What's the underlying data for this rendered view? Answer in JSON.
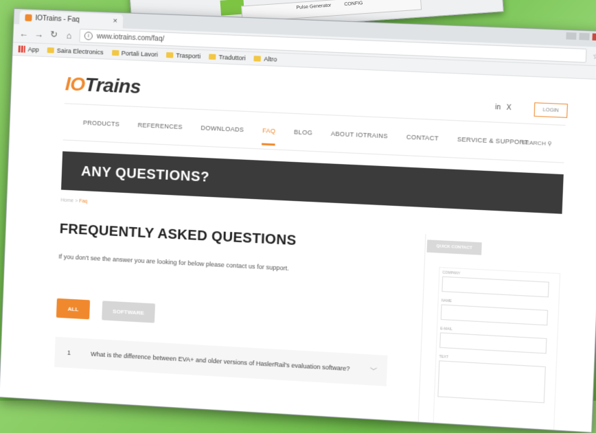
{
  "browser": {
    "tab_title": "IOTrains - Faq",
    "tab_close": "×",
    "url": "www.iotrains.com/faq/",
    "info_glyph": "i",
    "bookmarks": [
      "App",
      "Saira Electronics",
      "Portali Lavori",
      "Trasporti",
      "Traduttori",
      "Altro"
    ]
  },
  "site": {
    "logo_io": "IO",
    "logo_rest": "Trains",
    "social_linkedin": "in",
    "social_xing": "X",
    "login": "LOGIN",
    "nav": [
      "PRODUCTS",
      "REFERENCES",
      "DOWNLOADS",
      "FAQ",
      "BLOG",
      "ABOUT IOTRAINS",
      "CONTACT",
      "SERVICE & SUPPORT"
    ],
    "search": "SEARCH",
    "banner": "ANY QUESTIONS?",
    "crumb_home": "Home",
    "crumb_sep": ">",
    "crumb_current": "Faq",
    "faq_title": "FREQUENTLY ASKED QUESTIONS",
    "faq_intro": "If you don't see the answer you are looking for below please contact us for support.",
    "filter_all": "ALL",
    "filter_software": "SOFTWARE",
    "faq_items": [
      {
        "num": "1",
        "question": "What is the difference between EVA+ and older versions of HaslerRail's evaluation software?"
      }
    ],
    "quick_contact": "QUICK CONTACT",
    "form_labels": [
      "COMPANY",
      "NAME",
      "E-MAIL",
      "TEXT"
    ]
  },
  "back_window": {
    "label1": "Pulse Generator",
    "label2": "CONFIG"
  }
}
